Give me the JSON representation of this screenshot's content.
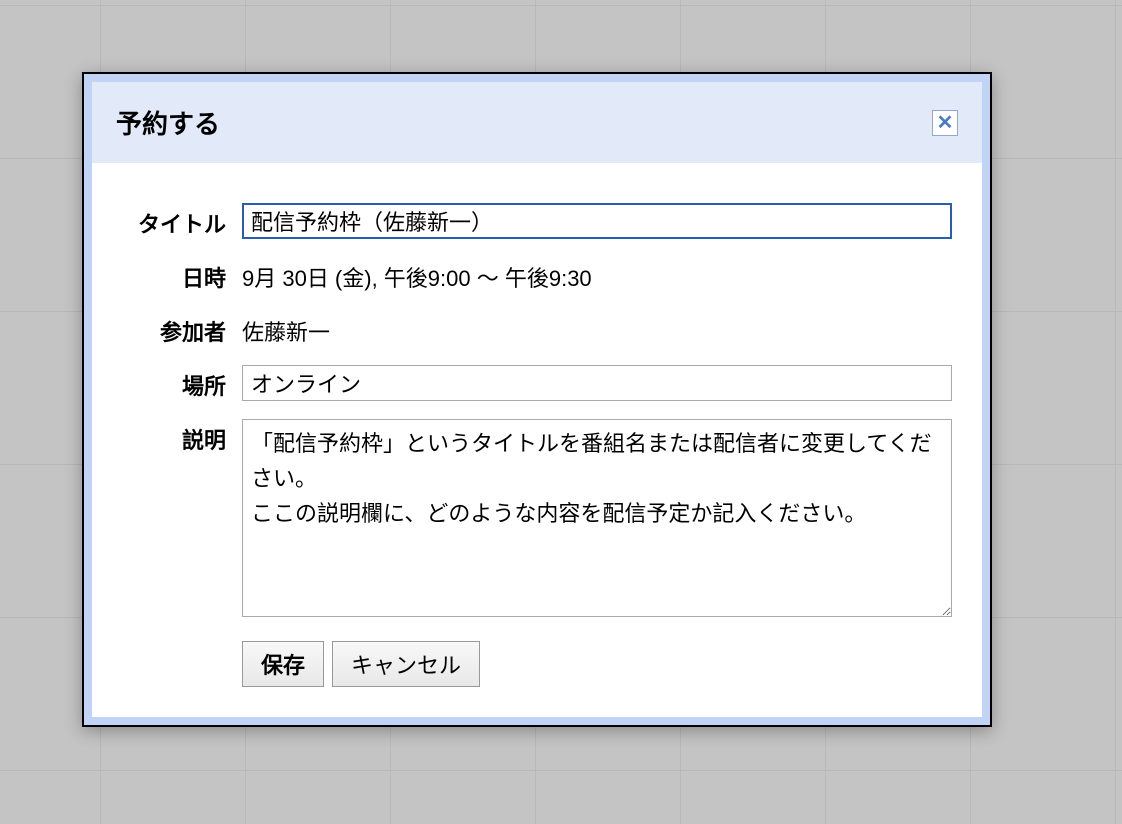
{
  "dialog": {
    "title": "予約する",
    "close_label": "✕"
  },
  "form": {
    "title_label": "タイトル",
    "title_value": "配信予約枠（佐藤新一）",
    "datetime_label": "日時",
    "datetime_value": "9月 30日 (金), 午後9:00 〜 午後9:30",
    "attendee_label": "参加者",
    "attendee_value": "佐藤新一",
    "location_label": "場所",
    "location_value": "オンライン",
    "description_label": "説明",
    "description_value": "「配信予約枠」というタイトルを番組名または配信者に変更してください。\nここの説明欄に、どのような内容を配信予定か記入ください。"
  },
  "buttons": {
    "save": "保存",
    "cancel": "キャンセル"
  }
}
